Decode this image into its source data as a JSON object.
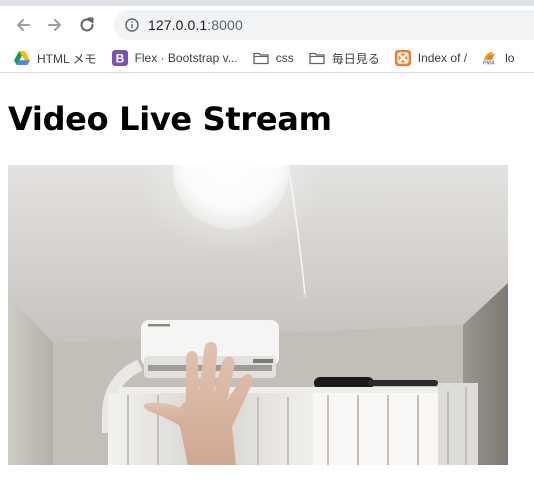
{
  "browser": {
    "url": {
      "host": "127.0.0.1",
      "port": ":8000"
    },
    "bookmarks": [
      {
        "label": "HTML メモ",
        "icon": "google-drive-icon"
      },
      {
        "label": "Flex · Bootstrap v...",
        "icon": "bootstrap-icon"
      },
      {
        "label": "css",
        "icon": "folder-icon"
      },
      {
        "label": "毎日見る",
        "icon": "folder-icon"
      },
      {
        "label": "Index of /",
        "icon": "xampp-icon"
      },
      {
        "label": "lo",
        "icon": "phpmyadmin-icon"
      }
    ],
    "colors": {
      "bootstrap": "#7952b3",
      "xampp": "#fb7a24"
    }
  },
  "page": {
    "title": "Video Live Stream"
  },
  "video": {
    "description": "live camera stream"
  }
}
